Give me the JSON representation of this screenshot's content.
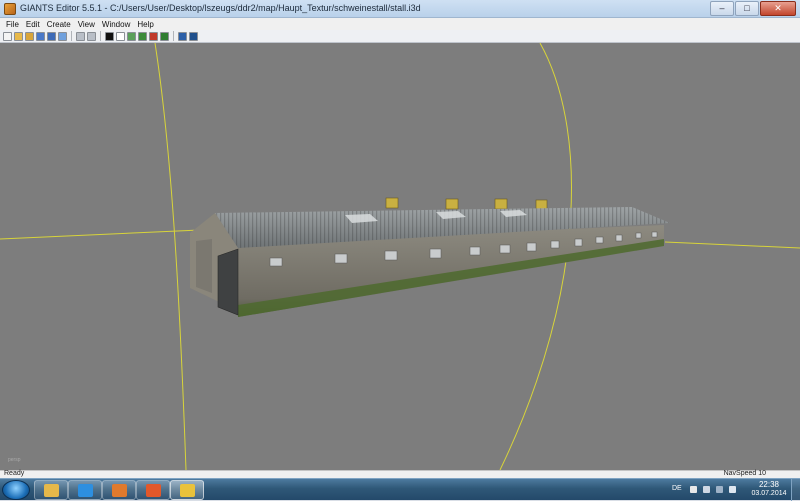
{
  "window": {
    "title": "GIANTS Editor 5.5.1 - C:/Users/User/Desktop/lszeugs/ddr2/map/Haupt_Textur/schweinestall/stall.i3d",
    "controls": {
      "minimize": "–",
      "maximize": "□",
      "close": "✕"
    }
  },
  "menu": {
    "items": [
      "File",
      "Edit",
      "Create",
      "View",
      "Window",
      "Help"
    ]
  },
  "toolbar": {
    "icons": [
      {
        "name": "new-icon",
        "color": "#f4f4f4"
      },
      {
        "name": "open-icon",
        "color": "#e8b94a"
      },
      {
        "name": "open-recent-icon",
        "color": "#d9a53a"
      },
      {
        "name": "save-icon",
        "color": "#4a79c9"
      },
      {
        "name": "save-as-icon",
        "color": "#3d6bb8"
      },
      {
        "name": "export-icon",
        "color": "#6fa0dd"
      },
      {
        "name": "undo-icon",
        "color": "#b9bfc8"
      },
      {
        "name": "redo-icon",
        "color": "#b9bfc8"
      },
      {
        "name": "play-icon",
        "color": "#111111"
      },
      {
        "name": "select-icon",
        "color": "#ffffff"
      },
      {
        "name": "terrain-icon",
        "color": "#5aa05a"
      },
      {
        "name": "paint-icon",
        "color": "#3b8b3b"
      },
      {
        "name": "foliage-icon",
        "color": "#c0392b"
      },
      {
        "name": "placement-icon",
        "color": "#2e7d32"
      },
      {
        "name": "settings-icon",
        "color": "#2b5fa8"
      },
      {
        "name": "world-icon",
        "color": "#1e4f8c"
      }
    ]
  },
  "status": {
    "left": "Ready",
    "right": "NavSpeed 10",
    "viewport_label": "persp"
  },
  "taskbar": {
    "apps": [
      {
        "name": "explorer-app",
        "color": "#e6b84a"
      },
      {
        "name": "ie-app",
        "color": "#2d8fe0"
      },
      {
        "name": "media-app",
        "color": "#e07a2d"
      },
      {
        "name": "firefox-app",
        "color": "#e2582b"
      },
      {
        "name": "giants-editor-app",
        "color": "#e9c23b"
      }
    ],
    "language": "DE",
    "time": "22:38",
    "date": "03.07.2014"
  }
}
